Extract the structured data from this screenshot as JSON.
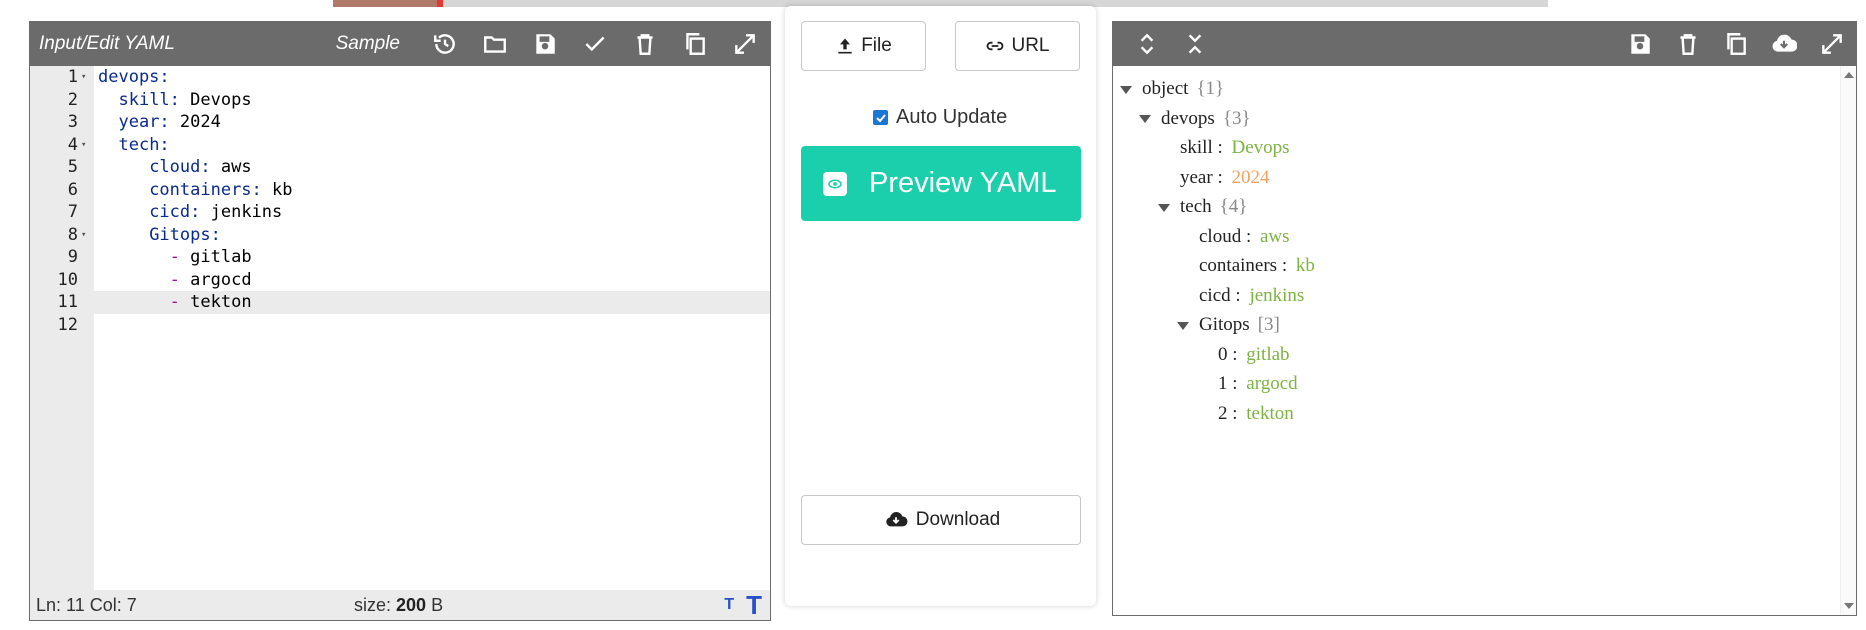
{
  "editor": {
    "title": "Input/Edit YAML",
    "sample_label": "Sample",
    "lines": [
      {
        "n": "1",
        "fold": "▾",
        "indent": "",
        "key": "devops:",
        "dash": "",
        "val": ""
      },
      {
        "n": "2",
        "fold": "",
        "indent": "  ",
        "key": "skill:",
        "dash": "",
        "val": " Devops"
      },
      {
        "n": "3",
        "fold": "",
        "indent": "  ",
        "key": "year:",
        "dash": "",
        "val": " 2024"
      },
      {
        "n": "4",
        "fold": "▾",
        "indent": "  ",
        "key": "tech:",
        "dash": "",
        "val": ""
      },
      {
        "n": "5",
        "fold": "",
        "indent": "     ",
        "key": "cloud:",
        "dash": "",
        "val": " aws"
      },
      {
        "n": "6",
        "fold": "",
        "indent": "     ",
        "key": "containers:",
        "dash": "",
        "val": " kb"
      },
      {
        "n": "7",
        "fold": "",
        "indent": "     ",
        "key": "cicd:",
        "dash": "",
        "val": " jenkins"
      },
      {
        "n": "8",
        "fold": "▾",
        "indent": "     ",
        "key": "Gitops:",
        "dash": "",
        "val": ""
      },
      {
        "n": "9",
        "fold": "",
        "indent": "       ",
        "key": "",
        "dash": "-",
        "val": " gitlab"
      },
      {
        "n": "10",
        "fold": "",
        "indent": "       ",
        "key": "",
        "dash": "-",
        "val": " argocd"
      },
      {
        "n": "11",
        "fold": "",
        "indent": "       ",
        "key": "",
        "dash": "-",
        "val": " tekton"
      },
      {
        "n": "12",
        "fold": "",
        "indent": "",
        "key": "",
        "dash": "",
        "val": ""
      }
    ],
    "active_line": "11",
    "status_position": "Ln: 11 Col: 7",
    "size_label": "size: ",
    "size_value": "200",
    "size_unit": " B"
  },
  "middle": {
    "file_label": "File",
    "url_label": "URL",
    "auto_update_label": "Auto Update",
    "auto_update_checked": true,
    "preview_label": "Preview YAML",
    "download_label": "Download",
    "accent": "#1ccfac"
  },
  "tree": {
    "nodes": [
      {
        "depth": 0,
        "caret": true,
        "key": "object",
        "sep": "",
        "count": "{1}",
        "val": "",
        "vtype": ""
      },
      {
        "depth": 1,
        "caret": true,
        "key": "devops",
        "sep": "",
        "count": "{3}",
        "val": "",
        "vtype": ""
      },
      {
        "depth": 2,
        "caret": false,
        "key": "skill",
        "sep": " : ",
        "count": "",
        "val": "Devops",
        "vtype": "string"
      },
      {
        "depth": 2,
        "caret": false,
        "key": "year",
        "sep": " : ",
        "count": "",
        "val": "2024",
        "vtype": "number"
      },
      {
        "depth": 2,
        "caret": true,
        "key": "tech",
        "sep": "",
        "count": "{4}",
        "val": "",
        "vtype": ""
      },
      {
        "depth": 3,
        "caret": false,
        "key": "cloud",
        "sep": " : ",
        "count": "",
        "val": "aws",
        "vtype": "string"
      },
      {
        "depth": 3,
        "caret": false,
        "key": "containers",
        "sep": " : ",
        "count": "",
        "val": "kb",
        "vtype": "string"
      },
      {
        "depth": 3,
        "caret": false,
        "key": "cicd",
        "sep": " : ",
        "count": "",
        "val": "jenkins",
        "vtype": "string"
      },
      {
        "depth": 3,
        "caret": true,
        "key": "Gitops",
        "sep": "",
        "count": "[3]",
        "val": "",
        "vtype": ""
      },
      {
        "depth": 4,
        "caret": false,
        "key": "0",
        "sep": " : ",
        "count": "",
        "val": "gitlab",
        "vtype": "string"
      },
      {
        "depth": 4,
        "caret": false,
        "key": "1",
        "sep": " : ",
        "count": "",
        "val": "argocd",
        "vtype": "string"
      },
      {
        "depth": 4,
        "caret": false,
        "key": "2",
        "sep": " : ",
        "count": "",
        "val": "tekton",
        "vtype": "string"
      }
    ]
  },
  "colors": {
    "header_bg": "#6b6b6b",
    "string_value": "#7cb342",
    "number_value": "#f0a15e",
    "yaml_key": "#0a2a8c",
    "yaml_dash": "#a0109b"
  }
}
